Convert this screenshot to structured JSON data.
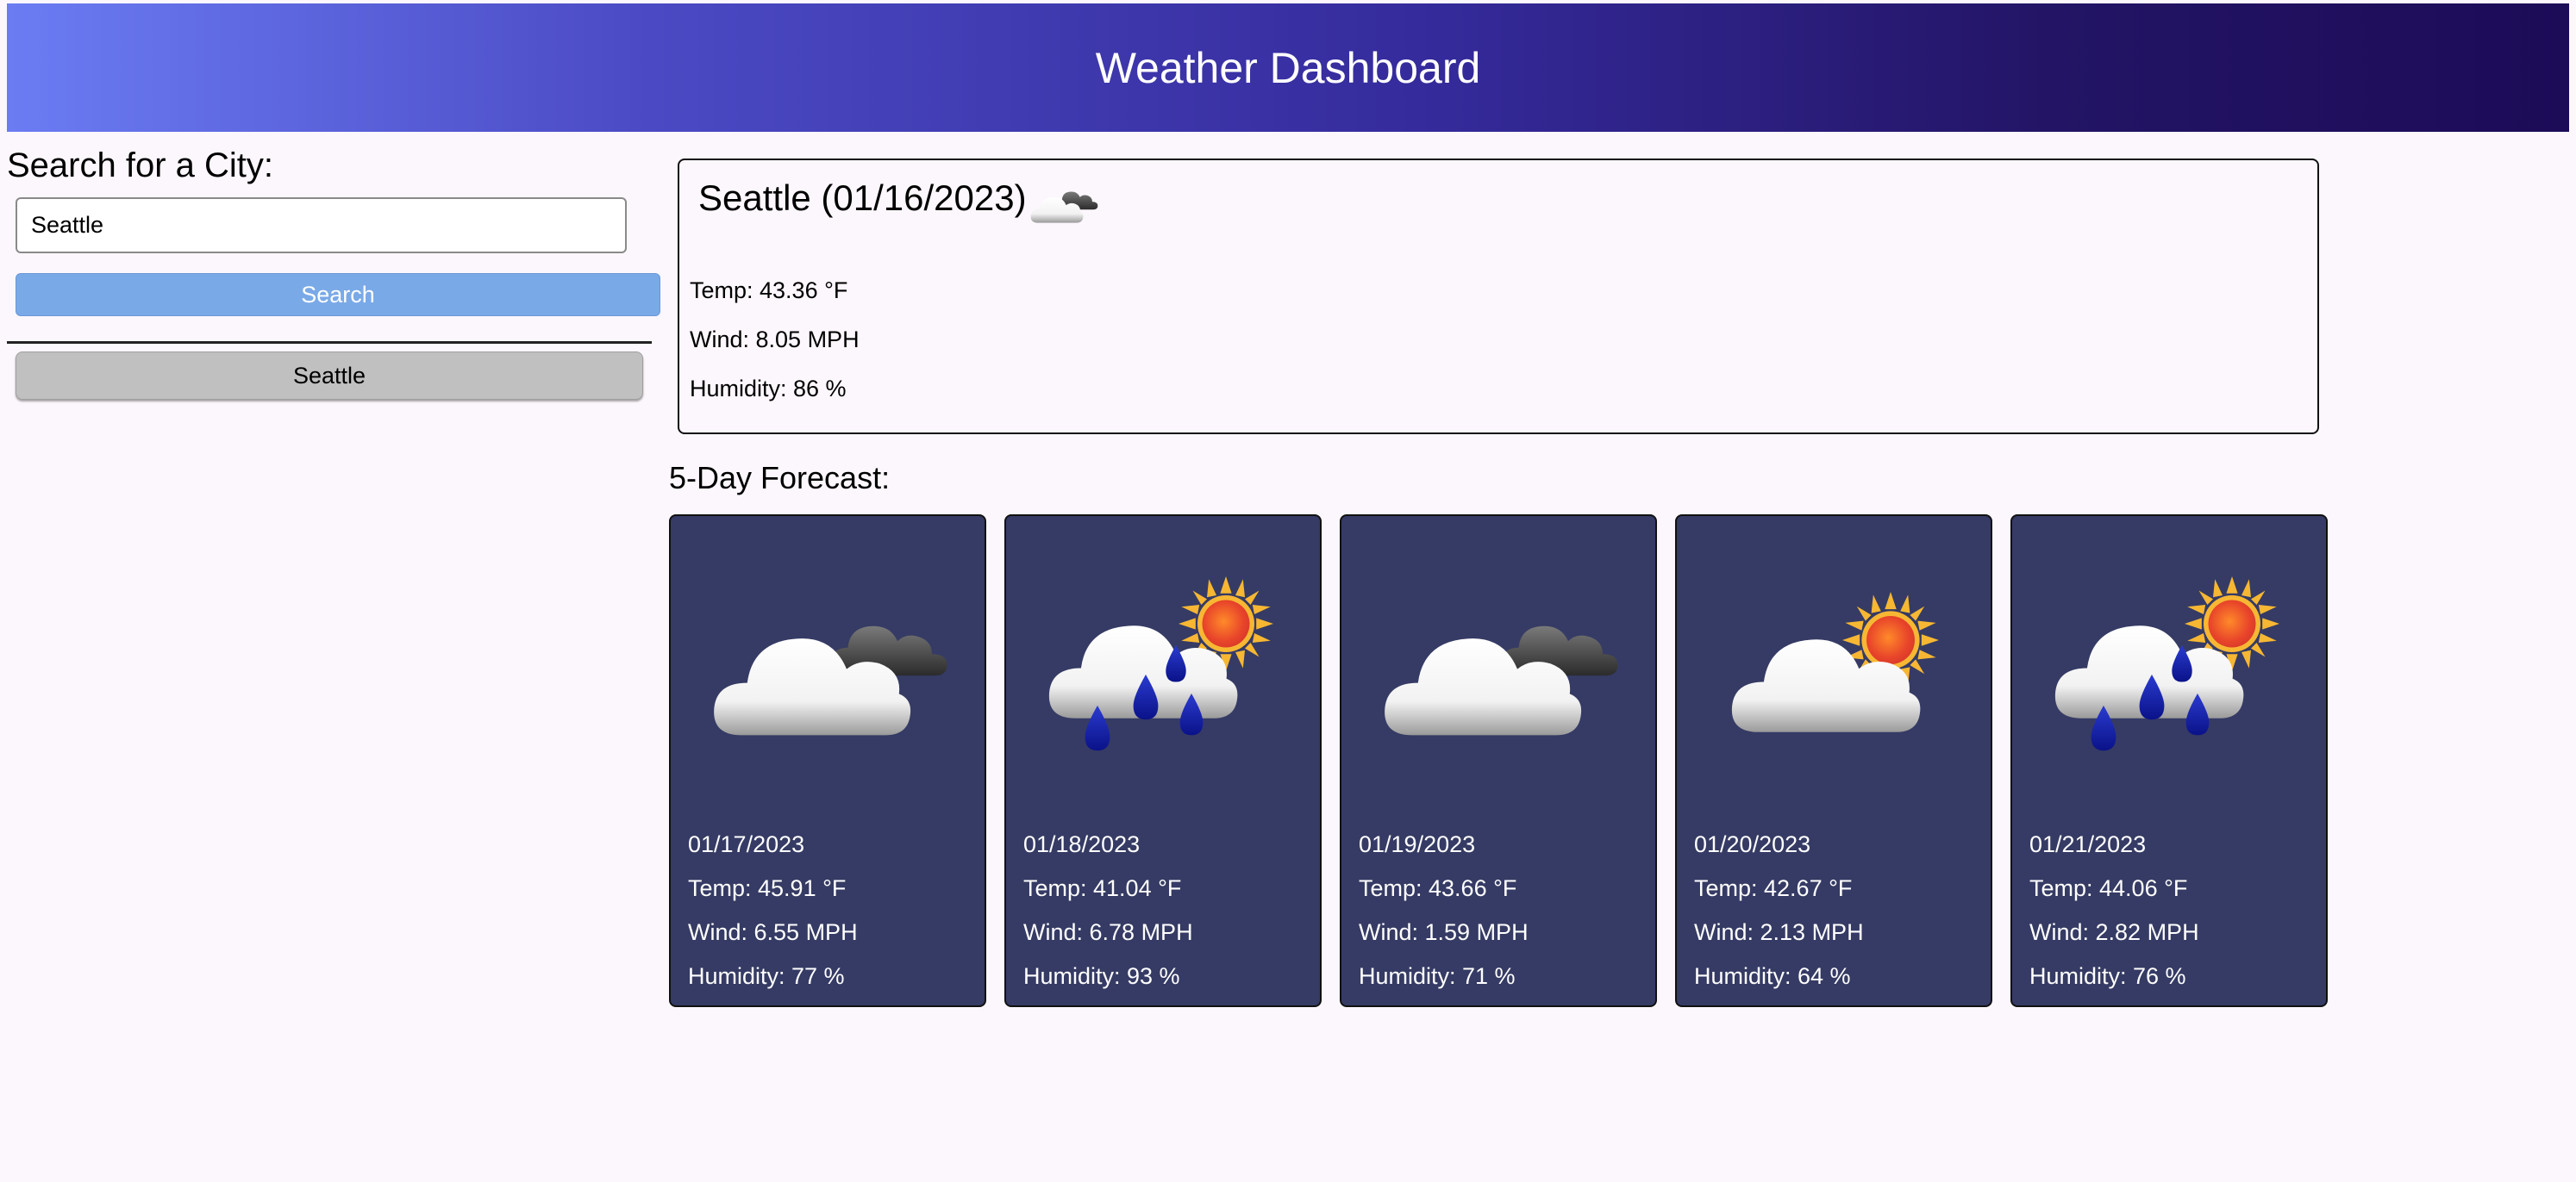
{
  "header": {
    "title": "Weather Dashboard"
  },
  "sidebar": {
    "heading": "Search for a City:",
    "search_value": "Seattle",
    "search_button_label": "Search",
    "history": [
      {
        "label": "Seattle"
      }
    ]
  },
  "current": {
    "title": "Seattle (01/16/2023)",
    "icon": "partly-cloudy-icon",
    "temp": "Temp: 43.36 °F",
    "wind": "Wind: 8.05 MPH",
    "humidity": "Humidity: 86 %"
  },
  "forecast": {
    "heading": "5-Day Forecast:",
    "days": [
      {
        "date": "01/17/2023",
        "icon": "cloudy-icon",
        "temp": "Temp: 45.91 °F",
        "wind": "Wind: 6.55 MPH",
        "humidity": "Humidity: 77 %"
      },
      {
        "date": "01/18/2023",
        "icon": "rain-sun-icon",
        "temp": "Temp: 41.04 °F",
        "wind": "Wind: 6.78 MPH",
        "humidity": "Humidity: 93 %"
      },
      {
        "date": "01/19/2023",
        "icon": "cloudy-icon",
        "temp": "Temp: 43.66 °F",
        "wind": "Wind: 1.59 MPH",
        "humidity": "Humidity: 71 %"
      },
      {
        "date": "01/20/2023",
        "icon": "partly-sunny-icon",
        "temp": "Temp: 42.67 °F",
        "wind": "Wind: 2.13 MPH",
        "humidity": "Humidity: 64 %"
      },
      {
        "date": "01/21/2023",
        "icon": "rain-sun-icon",
        "temp": "Temp: 44.06 °F",
        "wind": "Wind: 2.82 MPH",
        "humidity": "Humidity: 76 %"
      }
    ]
  },
  "colors": {
    "header_gradient_start": "#6b7cf3",
    "header_gradient_end": "#1c0b57",
    "search_button": "#7aa9e7",
    "history_button": "#c0c0c0",
    "forecast_card": "#353b64",
    "page_background": "#fcf7fc"
  }
}
